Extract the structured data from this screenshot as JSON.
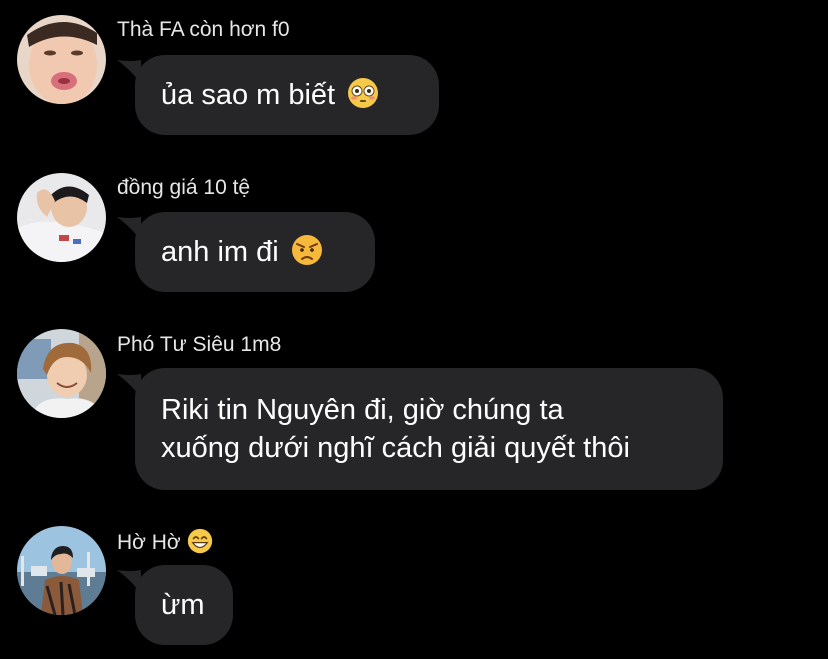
{
  "colors": {
    "background": "#000000",
    "bubble": "#262628",
    "sender_text": "#e6e6e6",
    "message_text": "#ffffff"
  },
  "messages": [
    {
      "sender": "Thà FA còn hơn f0",
      "text": "ủa sao m biết",
      "emoji": "flushed-face-emoji",
      "avatar": "pouting-face-avatar"
    },
    {
      "sender": "đồng giá 10 tệ",
      "text": "anh im đi",
      "emoji": "angry-face-emoji",
      "avatar": "reclining-man-avatar"
    },
    {
      "sender": "Phó Tư Siêu 1m8",
      "text_line1": "Riki tin Nguyên đi, giờ chúng ta",
      "text_line2": "xuống dưới nghĩ cách giải quyết thôi",
      "avatar": "smiling-boy-avatar"
    },
    {
      "sender": "Hờ Hờ",
      "sender_emoji": "grinning-face-emoji",
      "text": "ừm",
      "avatar": "harbor-man-avatar"
    }
  ]
}
